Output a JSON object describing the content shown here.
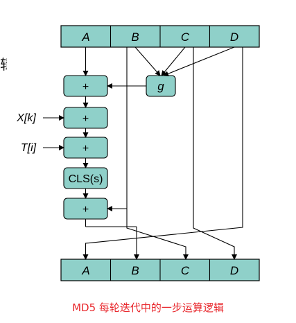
{
  "registers_top": [
    "A",
    "B",
    "C",
    "D"
  ],
  "registers_bottom": [
    "A",
    "B",
    "C",
    "D"
  ],
  "operations": {
    "add1": "+",
    "add2": "+",
    "add3": "+",
    "cls": "CLS(s)",
    "add4": "+",
    "g": "g"
  },
  "inputs": {
    "x": "X[k]",
    "t": "T[i]"
  },
  "caption": "MD5 每轮迭代中的一步运算逻辑",
  "edge_text": "辑",
  "colors": {
    "box_fill": "#8fd0c9",
    "caption": "#e8262b"
  }
}
